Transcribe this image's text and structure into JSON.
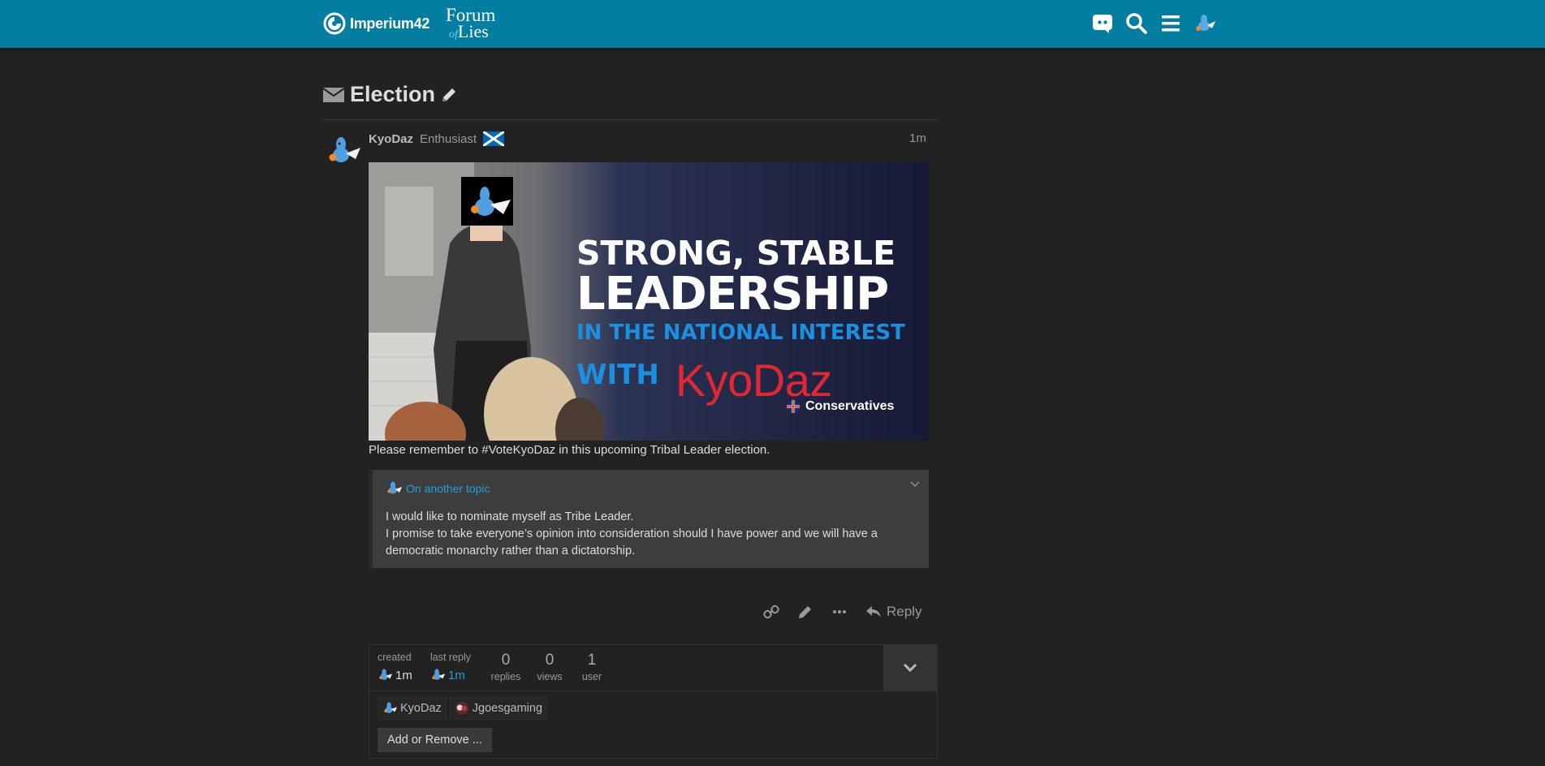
{
  "header": {
    "site_name": "Imperium42",
    "forum_logo_line1": "Forum",
    "forum_logo_of": "of",
    "forum_logo_line2": "Lies",
    "icons": [
      "discord-icon",
      "search-icon",
      "menu-icon",
      "user-avatar-icon"
    ],
    "bar_color": "#047ea0"
  },
  "topic": {
    "title": "Election",
    "post": {
      "username": "KyoDaz",
      "user_title": "Enthusiast",
      "flair": "scotland-flag",
      "date": "1m",
      "banner": {
        "line1": "STRONG, STABLE",
        "line2": "LEADERSHIP",
        "line3": "IN THE NATIONAL INTEREST",
        "line4": "WITH",
        "name": "KyoDaz",
        "party": "Conservatives"
      },
      "body": "Please remember to #VoteKyoDaz in this upcoming Tribal Leader election.",
      "quote": {
        "link_text": "On another topic",
        "line1": "I would like to nominate myself as Tribe Leader.",
        "line2": "I promise to take everyone’s opinion into consideration should I have power and we will have a democratic monarchy rather than a dictatorship."
      },
      "actions": {
        "reply_label": "Reply"
      }
    },
    "map": {
      "created_label": "created",
      "created_value": "1m",
      "last_reply_label": "last reply",
      "last_reply_value": "1m",
      "replies_count": "0",
      "replies_label": "replies",
      "views_count": "0",
      "views_label": "views",
      "users_count": "1",
      "users_label": "user",
      "participants": [
        "KyoDaz",
        "Jgoesgaming"
      ],
      "add_remove_label": "Add or Remove ..."
    }
  },
  "colors": {
    "background": "#222222",
    "accent": "#047ea0",
    "link": "#1ea2d8",
    "kyodaz_red": "#e12734",
    "banner_blue": "#1b8fe0"
  }
}
